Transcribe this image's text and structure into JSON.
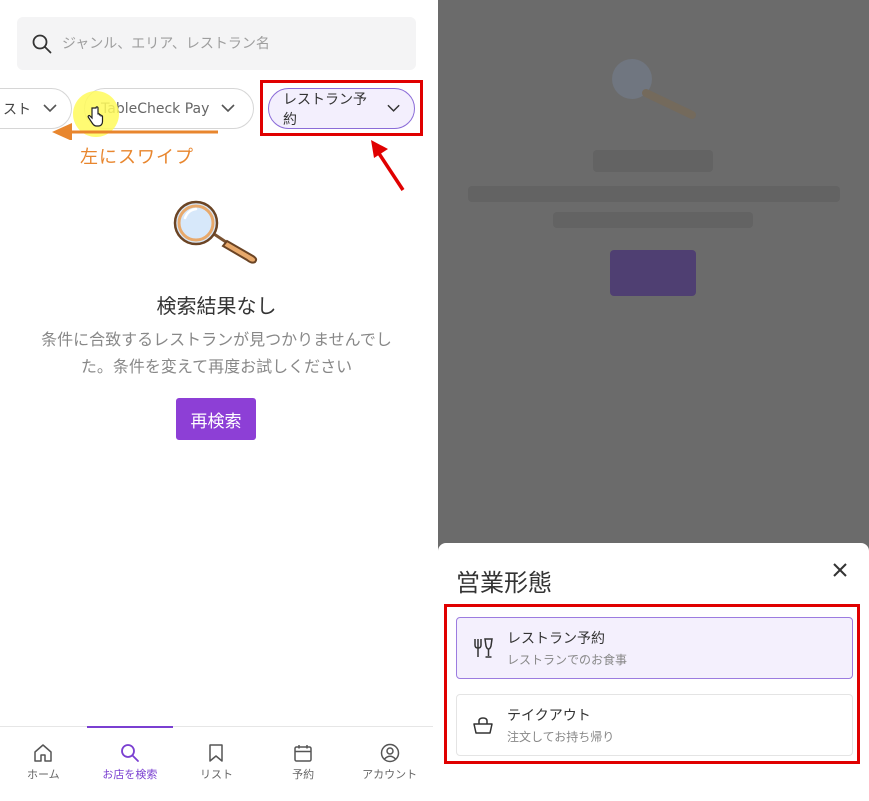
{
  "left": {
    "search": {
      "placeholder": "ジャンル、エリア、レストラン名"
    },
    "chips": [
      {
        "label": "リスト"
      },
      {
        "label": "TableCheck Pay"
      },
      {
        "label": "レストラン予約"
      }
    ],
    "swipe_hint": "左にスワイプ",
    "empty": {
      "title": "検索結果なし",
      "description": "条件に合致するレストランが見つかりませんでした。条件を変えて再度お試しください",
      "retry_label": "再検索"
    },
    "nav": [
      {
        "label": "ホーム",
        "icon": "home-icon"
      },
      {
        "label": "お店を検索",
        "icon": "search-icon",
        "active": true
      },
      {
        "label": "リスト",
        "icon": "bookmark-icon"
      },
      {
        "label": "予約",
        "icon": "calendar-icon"
      },
      {
        "label": "アカウント",
        "icon": "account-icon"
      }
    ]
  },
  "right": {
    "sheet": {
      "title": "営業形態",
      "options": [
        {
          "label": "レストラン予約",
          "sub": "レストランでのお食事",
          "icon": "cutlery-icon",
          "selected": true
        },
        {
          "label": "テイクアウト",
          "sub": "注文してお持ち帰り",
          "icon": "basket-icon",
          "selected": false
        }
      ]
    }
  },
  "colors": {
    "accent": "#8d3fd6",
    "highlight": "#e00000",
    "swipe": "#e8862e"
  }
}
